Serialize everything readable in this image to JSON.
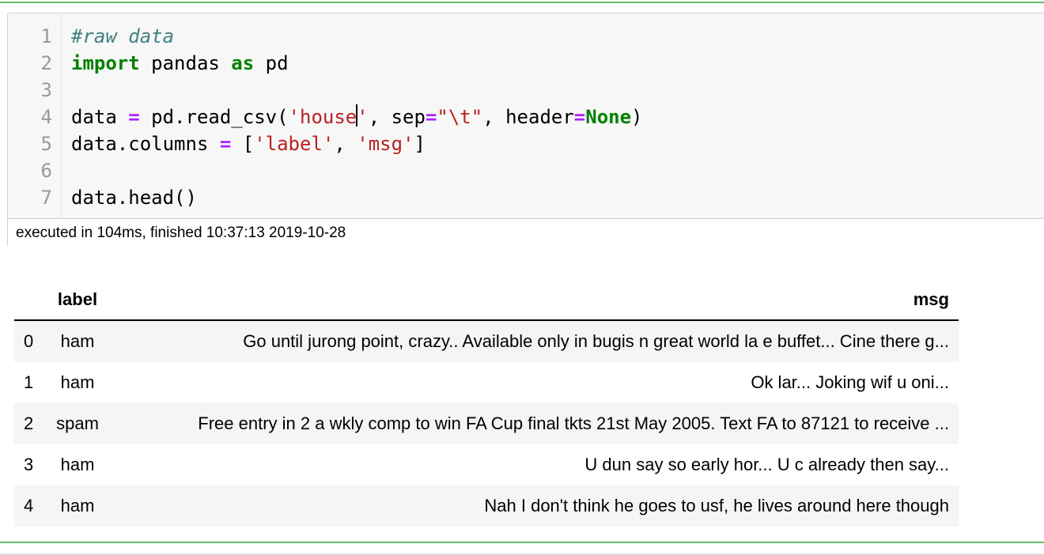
{
  "code": {
    "lines": [
      {
        "n": "1",
        "parts": [
          {
            "t": "#raw data",
            "c": "cm"
          }
        ]
      },
      {
        "n": "2",
        "parts": [
          {
            "t": "import",
            "c": "kw"
          },
          {
            "t": " pandas ",
            "c": ""
          },
          {
            "t": "as",
            "c": "kw"
          },
          {
            "t": " pd",
            "c": ""
          }
        ]
      },
      {
        "n": "3",
        "parts": []
      },
      {
        "n": "4",
        "parts": [
          {
            "t": "data ",
            "c": ""
          },
          {
            "t": "=",
            "c": "op"
          },
          {
            "t": " pd.read_csv(",
            "c": ""
          },
          {
            "t": "'house",
            "c": "st"
          },
          {
            "t": "",
            "c": "cursor"
          },
          {
            "t": "'",
            "c": "st"
          },
          {
            "t": ", sep",
            "c": ""
          },
          {
            "t": "=",
            "c": "op"
          },
          {
            "t": "\"\\t\"",
            "c": "st"
          },
          {
            "t": ", header",
            "c": ""
          },
          {
            "t": "=",
            "c": "op"
          },
          {
            "t": "None",
            "c": "kw"
          },
          {
            "t": ")",
            "c": ""
          }
        ]
      },
      {
        "n": "5",
        "parts": [
          {
            "t": "data.columns ",
            "c": ""
          },
          {
            "t": "=",
            "c": "op"
          },
          {
            "t": " [",
            "c": ""
          },
          {
            "t": "'label'",
            "c": "st"
          },
          {
            "t": ", ",
            "c": ""
          },
          {
            "t": "'msg'",
            "c": "st"
          },
          {
            "t": "]",
            "c": ""
          }
        ]
      },
      {
        "n": "6",
        "parts": []
      },
      {
        "n": "7",
        "parts": [
          {
            "t": "data.head()",
            "c": ""
          }
        ]
      }
    ]
  },
  "execution": {
    "status": "executed in 104ms, finished 10:37:13 2019-10-28"
  },
  "table": {
    "headers": {
      "index": "",
      "label": "label",
      "msg": "msg"
    },
    "rows": [
      {
        "index": "0",
        "label": "ham",
        "msg": "Go until jurong point, crazy.. Available only in bugis n great world la e buffet... Cine there g..."
      },
      {
        "index": "1",
        "label": "ham",
        "msg": "Ok lar... Joking wif u oni..."
      },
      {
        "index": "2",
        "label": "spam",
        "msg": "Free entry in 2 a wkly comp to win FA Cup final tkts 21st May 2005. Text FA to 87121 to receive ..."
      },
      {
        "index": "3",
        "label": "ham",
        "msg": "U dun say so early hor... U c already then say..."
      },
      {
        "index": "4",
        "label": "ham",
        "msg": "Nah I don't think he goes to usf, he lives around here though"
      }
    ]
  }
}
